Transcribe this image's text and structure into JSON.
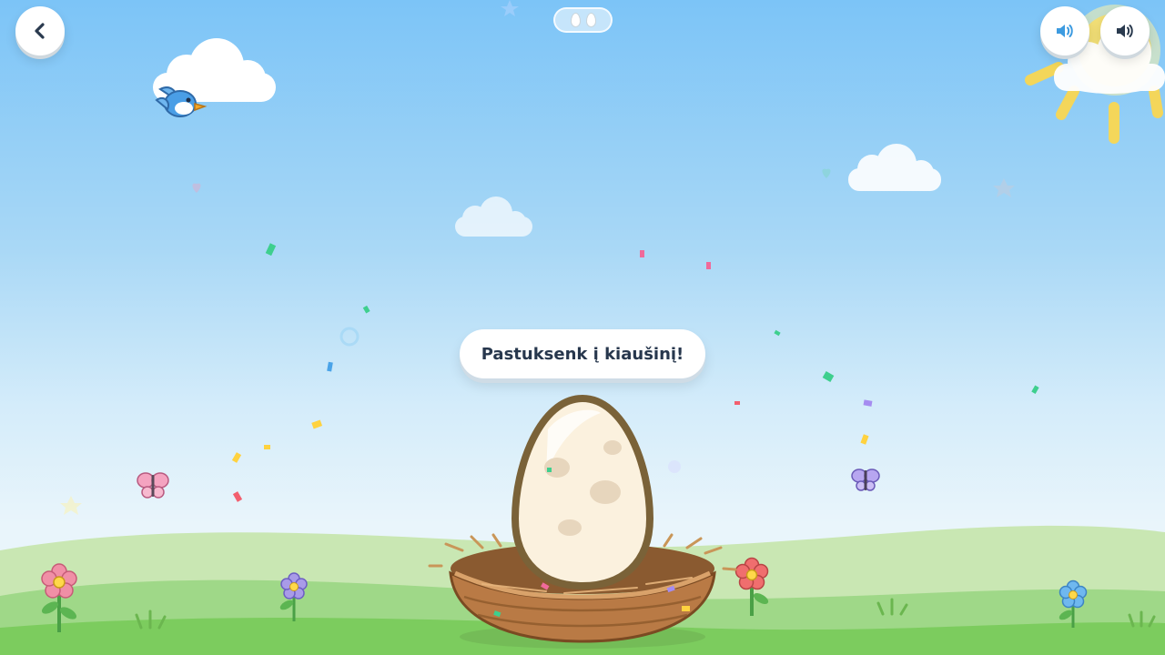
{
  "scene": {
    "name": "egg-hatching-game"
  },
  "toolbar": {
    "back_icon": "chevron-left-icon",
    "sound_icon": "speaker-icon",
    "voice_icon": "speaker-icon"
  },
  "progress": {
    "icon": "egg-icon",
    "total": 2,
    "completed": 0
  },
  "prompt": {
    "text": "Pastuksenk į kiaušinį!"
  },
  "colors": {
    "sky_top": "#7cc4f7",
    "grass": "#7ccc5e",
    "egg_shell": "#fbf1de",
    "egg_outline": "#7a6238",
    "nest": "#b97a45",
    "text": "#27374d",
    "sound_active": "#3d9be0"
  }
}
